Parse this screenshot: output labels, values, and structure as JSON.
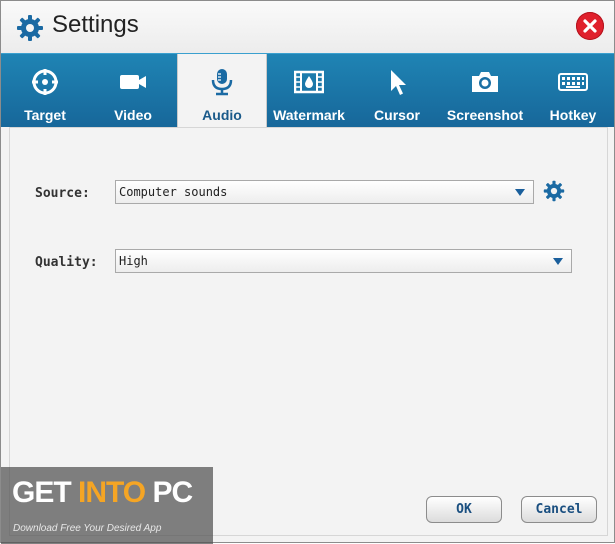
{
  "window": {
    "title": "Settings",
    "accent": "#17679a"
  },
  "tabs": [
    {
      "label": "Target",
      "icon": "target-icon"
    },
    {
      "label": "Video",
      "icon": "video-camera-icon"
    },
    {
      "label": "Audio",
      "icon": "microphone-icon",
      "active": true
    },
    {
      "label": "Watermark",
      "icon": "watermark-film-icon"
    },
    {
      "label": "Cursor",
      "icon": "cursor-arrow-icon"
    },
    {
      "label": "Screenshot",
      "icon": "camera-icon"
    },
    {
      "label": "Hotkey",
      "icon": "keyboard-icon"
    }
  ],
  "audio": {
    "source_label": "Source:",
    "source_value": "Computer sounds",
    "quality_label": "Quality:",
    "quality_value": "High"
  },
  "buttons": {
    "ok": "OK",
    "cancel": "Cancel"
  },
  "watermark": {
    "part1": "GET ",
    "part2": "INTO",
    "part3": " PC",
    "subtitle": "Download Free Your Desired App"
  }
}
